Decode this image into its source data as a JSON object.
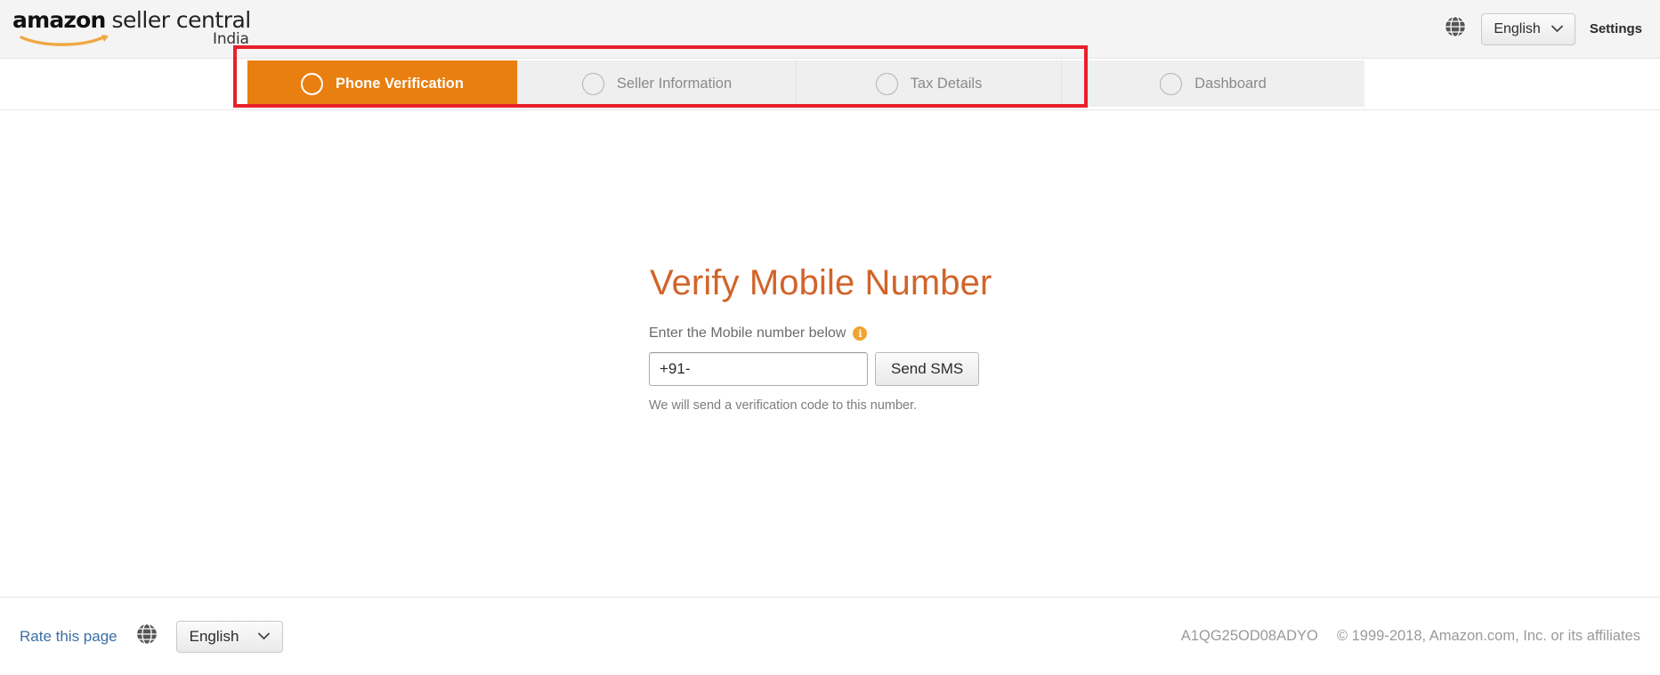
{
  "header": {
    "brand": {
      "amazon": "amazon",
      "seller_central": "seller central",
      "marketplace": "India"
    },
    "globe_icon": "globe-icon",
    "language": "English",
    "language_caret": "⌄",
    "settings": "Settings"
  },
  "progress_nav": {
    "tabs": [
      {
        "label": "Phone Verification",
        "state": "active"
      },
      {
        "label": "Seller Information",
        "state": "inactive"
      },
      {
        "label": "Tax Details",
        "state": "inactive"
      },
      {
        "label": "Dashboard",
        "state": "inactive"
      }
    ],
    "active_color": "#e87f10",
    "inactive_bg": "#efefef",
    "annotation_color": "#e8202a"
  },
  "main": {
    "title": "Verify Mobile Number",
    "title_color": "#d1642a",
    "field_label": "Enter the Mobile number below",
    "info_icon": "info-icon",
    "info_icon_glyph": "i",
    "phone_value": "+91-",
    "phone_placeholder": "+91-",
    "send_button": "Send SMS",
    "hint": "We will send a verification code to this number."
  },
  "footer": {
    "rate_this_page": "Rate this page",
    "globe_icon": "globe-icon",
    "language": "English",
    "language_caret": "⌄",
    "merchant_id": "A1QG25OD08ADYO",
    "copyright": "© 1999-2018, Amazon.com, Inc. or its affiliates"
  }
}
